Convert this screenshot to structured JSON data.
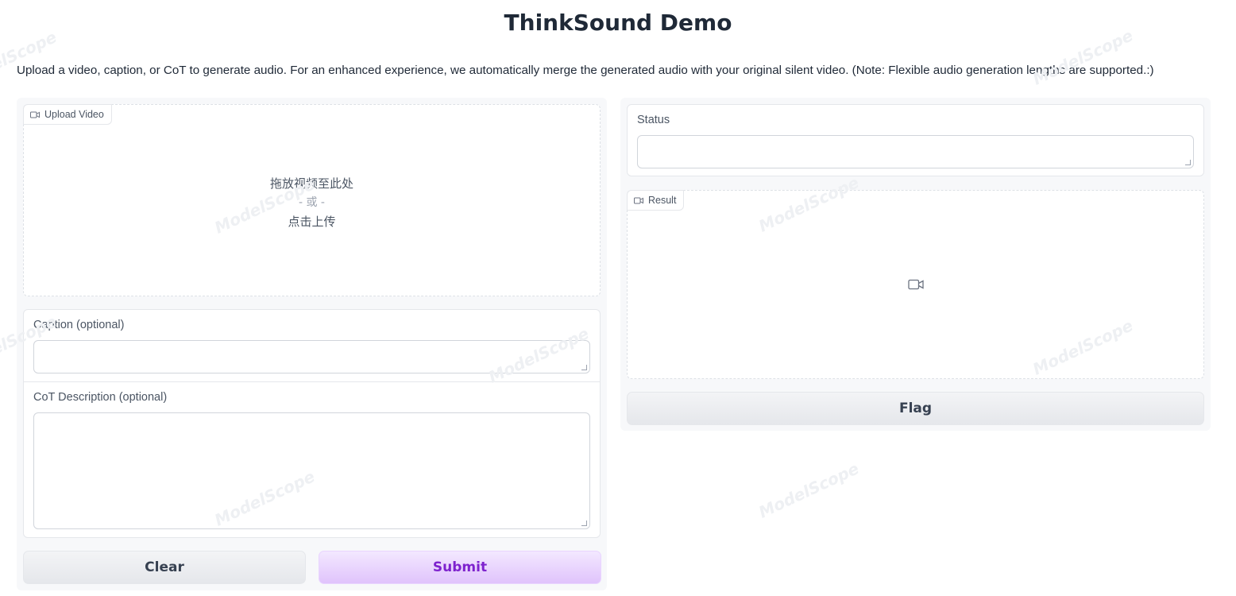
{
  "header": {
    "title": "ThinkSound Demo",
    "description": "Upload a video, caption, or CoT to generate audio. For an enhanced experience, we automatically merge the generated audio with your original silent video. (Note: Flexible audio generation lengths are supported.:)"
  },
  "left": {
    "upload": {
      "label": "Upload Video",
      "icon": "video-camera-icon",
      "drop_text": "拖放视频至此处",
      "or_text": "- 或 -",
      "click_text": "点击上传"
    },
    "caption": {
      "label": "Caption (optional)",
      "value": ""
    },
    "cot": {
      "label": "CoT Description (optional)",
      "value": ""
    },
    "buttons": {
      "clear": "Clear",
      "submit": "Submit"
    }
  },
  "right": {
    "status": {
      "label": "Status",
      "value": ""
    },
    "result": {
      "label": "Result",
      "icon": "video-camera-icon"
    },
    "flag_button": "Flag"
  },
  "watermark": "ModelScope",
  "colors": {
    "primary_text": "#7e22ce",
    "primary_bg": "#e0c3fc",
    "panel_bg": "#f7f8fa"
  }
}
